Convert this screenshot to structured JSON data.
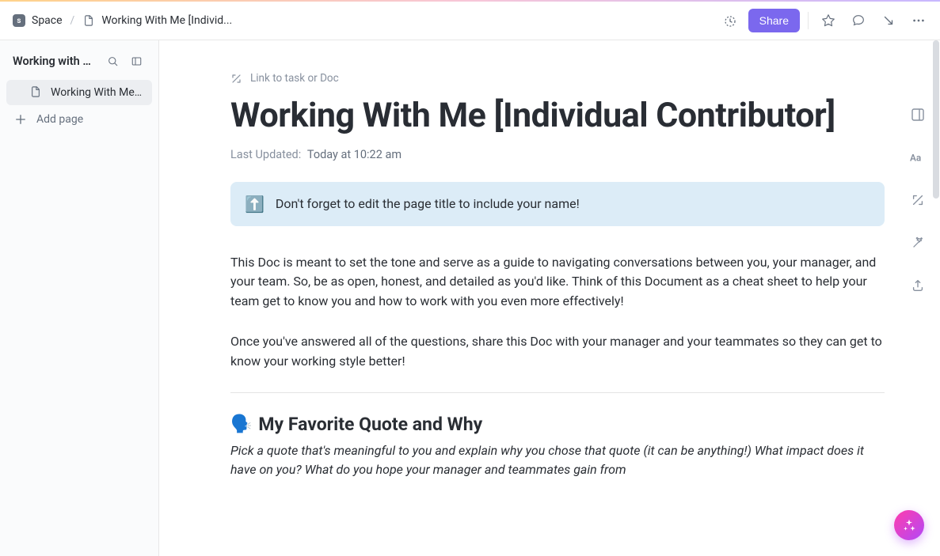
{
  "breadcrumbs": {
    "space_initial": "s",
    "space_label": "Space",
    "doc_label": "Working With Me [Individ..."
  },
  "header": {
    "share_label": "Share"
  },
  "sidebar": {
    "title": "Working with Me...",
    "active_item": "Working With Me ...",
    "add_page_label": "Add page"
  },
  "doc": {
    "link_task_label": "Link to task or Doc",
    "title": "Working With Me [Individual Contributor]",
    "last_updated_label": "Last Updated:",
    "last_updated_value": "Today at 10:22 am",
    "callout_emoji": "⬆️",
    "callout_text": "Don't forget to edit the page title to include your name!",
    "paragraph1": "This Doc is meant to set the tone and serve as a guide to navigating conversations between you, your manager, and your team. So, be as open, honest, and detailed as you'd like. Think of this Document as a cheat sheet to help your team get to know you and how to work with you even more effectively!",
    "paragraph2": "Once you've answered all of the questions, share this Doc with your manager and your teammates so they can get to know your working style better!",
    "section1_emoji": "🗣️",
    "section1_title": "My Favorite Quote and Why",
    "section1_desc": "Pick a quote that's meaningful to you and explain why you chose that quote (it can be anything!) What impact does it have on you? What do you hope your manager and teammates gain from"
  }
}
